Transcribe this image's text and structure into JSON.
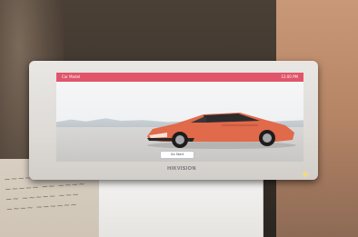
{
  "screen": {
    "topbar": {
      "title": "Car Model",
      "status": "12:00 PM"
    },
    "button_label": "Go   Start"
  },
  "hardware": {
    "brand": "HIKVISION"
  },
  "colors": {
    "topbar_bg": "#e0556a",
    "car_body": "#e06a4a",
    "bezel": "#e5e3e0"
  }
}
